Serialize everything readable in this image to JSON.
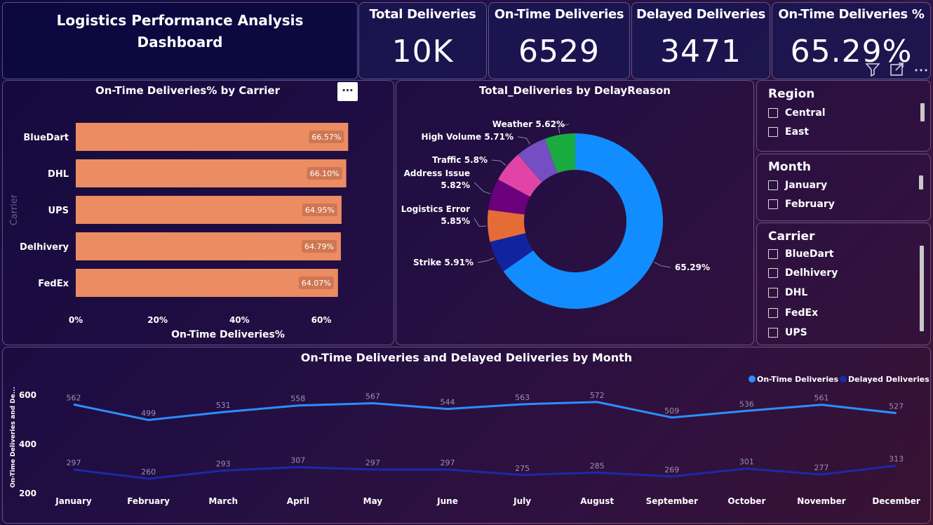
{
  "dashboard_title": "Logistics Performance Analysis Dashboard",
  "kpis": [
    {
      "label": "Total Deliveries",
      "value": "10K"
    },
    {
      "label": "On-Time Deliveries",
      "value": "6529"
    },
    {
      "label": "Delayed Deliveries",
      "value": "3471"
    },
    {
      "label": "On-Time Deliveries %",
      "value": "65.29%"
    }
  ],
  "carrier_chart": {
    "title": "On-Time Deliveries% by Carrier",
    "ylabel": "Carrier",
    "xlabel": "On-Time Deliveries%",
    "more_label": "⋯",
    "chart_data": {
      "type": "bar",
      "orientation": "horizontal",
      "categories": [
        "BlueDart",
        "DHL",
        "UPS",
        "Delhivery",
        "FedEx"
      ],
      "values": [
        66.57,
        66.1,
        64.95,
        64.79,
        64.07
      ],
      "value_labels": [
        "66.57%",
        "66.10%",
        "64.95%",
        "64.79%",
        "64.07%"
      ],
      "xticks": [
        "0%",
        "20%",
        "40%",
        "60%"
      ],
      "xlim": [
        0,
        70
      ],
      "bar_color": "#ec8c63"
    }
  },
  "donut_chart": {
    "title": "Total_Deliveries by DelayReason",
    "chart_data": {
      "type": "pie",
      "donut": true,
      "slices": [
        {
          "name": "On-Time",
          "value": 65.29,
          "label": [
            "65.29%"
          ],
          "color": "#118dff"
        },
        {
          "name": "Strike",
          "value": 5.91,
          "label": [
            "Strike 5.91%"
          ],
          "color": "#12239e"
        },
        {
          "name": "Logistics Error",
          "value": 5.85,
          "label": [
            "Logistics Error",
            "5.85%"
          ],
          "color": "#e66c37"
        },
        {
          "name": "Address Issue",
          "value": 5.82,
          "label": [
            "Address Issue",
            "5.82%"
          ],
          "color": "#6b007b"
        },
        {
          "name": "Traffic",
          "value": 5.8,
          "label": [
            "Traffic 5.8%"
          ],
          "color": "#e044a7"
        },
        {
          "name": "High Volume",
          "value": 5.71,
          "label": [
            "High Volume 5.71%"
          ],
          "color": "#744ec2"
        },
        {
          "name": "Weather",
          "value": 5.62,
          "label": [
            "Weather 5.62%"
          ],
          "color": "#1aab40"
        }
      ]
    }
  },
  "slicers": {
    "region": {
      "title": "Region",
      "items": [
        "Central",
        "East"
      ]
    },
    "month": {
      "title": "Month",
      "items": [
        "January",
        "February"
      ]
    },
    "carrier": {
      "title": "Carrier",
      "items": [
        "BlueDart",
        "Delhivery",
        "DHL",
        "FedEx",
        "UPS"
      ]
    }
  },
  "visual_header_icons": [
    "filter-icon",
    "focus-mode-icon",
    "more-options-icon"
  ],
  "month_chart": {
    "title": "On-Time Deliveries and Delayed Deliveries by Month",
    "ylabel": "On-Time Deliveries and De...",
    "chart_data": {
      "type": "line",
      "categories": [
        "January",
        "February",
        "March",
        "April",
        "May",
        "June",
        "July",
        "August",
        "September",
        "October",
        "November",
        "December"
      ],
      "series": [
        {
          "name": "On-Time Deliveries",
          "values": [
            562,
            499,
            531,
            558,
            567,
            544,
            563,
            572,
            509,
            536,
            561,
            527
          ],
          "color": "#2b8fff"
        },
        {
          "name": "Delayed Deliveries",
          "values": [
            297,
            260,
            293,
            307,
            297,
            297,
            275,
            285,
            269,
            301,
            277,
            313
          ],
          "color": "#1a2aa8"
        }
      ],
      "yticks": [
        200,
        400,
        600
      ],
      "ylim": [
        200,
        600
      ],
      "legend_position": "top-right"
    }
  }
}
